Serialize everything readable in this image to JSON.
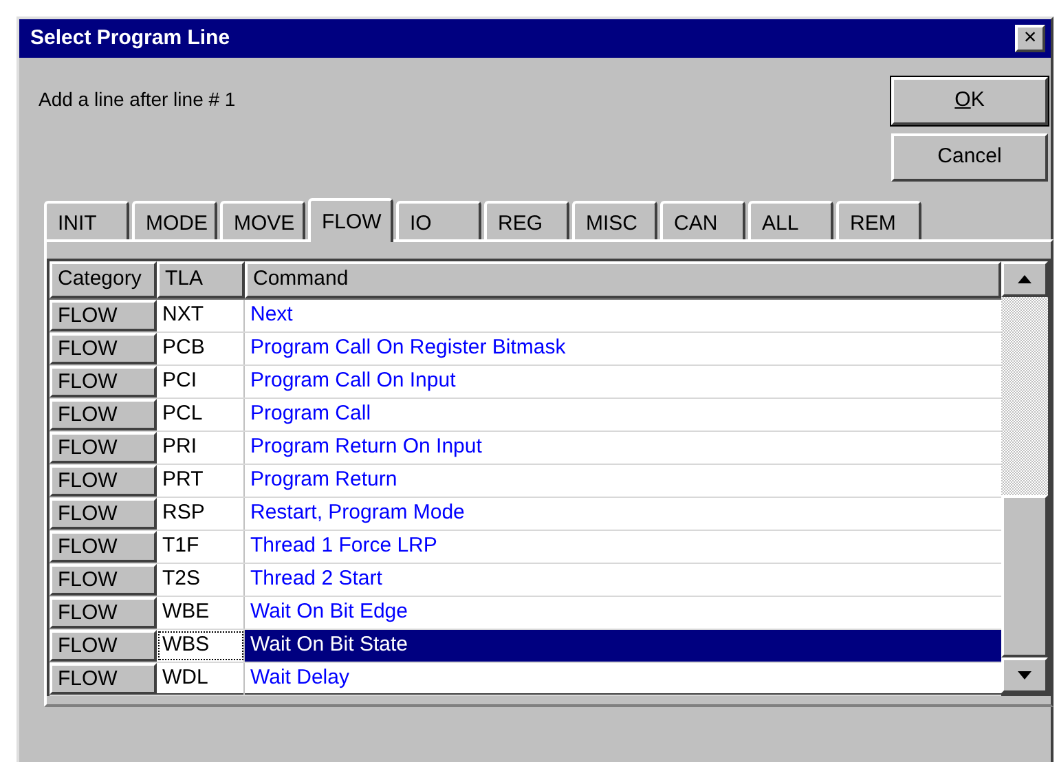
{
  "window": {
    "title": "Select Program Line",
    "close": "×"
  },
  "prompt": "Add a line after line # 1",
  "buttons": [
    {
      "label": "OK",
      "mnemonic_underlined": true,
      "default": true
    },
    {
      "label": "Cancel",
      "mnemonic_underlined": false,
      "default": false
    }
  ],
  "tabs": [
    {
      "label": "INIT",
      "selected": false
    },
    {
      "label": "MODE",
      "selected": false
    },
    {
      "label": "MOVE",
      "selected": false
    },
    {
      "label": "FLOW",
      "selected": true
    },
    {
      "label": "IO",
      "selected": false
    },
    {
      "label": "REG",
      "selected": false
    },
    {
      "label": "MISC",
      "selected": false
    },
    {
      "label": "CAN",
      "selected": false
    },
    {
      "label": "ALL",
      "selected": false
    },
    {
      "label": "REM",
      "selected": false
    }
  ],
  "table": {
    "columns": [
      "Category",
      "TLA",
      "Command"
    ],
    "rows": [
      {
        "category": "FLOW",
        "tla": "NXT",
        "command": "Next",
        "selected": false
      },
      {
        "category": "FLOW",
        "tla": "PCB",
        "command": "Program Call On Register Bitmask",
        "selected": false
      },
      {
        "category": "FLOW",
        "tla": "PCI",
        "command": "Program Call On Input",
        "selected": false
      },
      {
        "category": "FLOW",
        "tla": "PCL",
        "command": "Program Call",
        "selected": false
      },
      {
        "category": "FLOW",
        "tla": "PRI",
        "command": "Program Return On Input",
        "selected": false
      },
      {
        "category": "FLOW",
        "tla": "PRT",
        "command": "Program Return",
        "selected": false
      },
      {
        "category": "FLOW",
        "tla": "RSP",
        "command": "Restart, Program Mode",
        "selected": false
      },
      {
        "category": "FLOW",
        "tla": "T1F",
        "command": "Thread 1 Force LRP",
        "selected": false
      },
      {
        "category": "FLOW",
        "tla": "T2S",
        "command": "Thread 2 Start",
        "selected": false
      },
      {
        "category": "FLOW",
        "tla": "WBE",
        "command": "Wait On Bit Edge",
        "selected": false
      },
      {
        "category": "FLOW",
        "tla": "WBS",
        "command": "Wait On Bit State",
        "selected": true
      },
      {
        "category": "FLOW",
        "tla": "WDL",
        "command": "Wait Delay",
        "selected": false
      }
    ]
  }
}
